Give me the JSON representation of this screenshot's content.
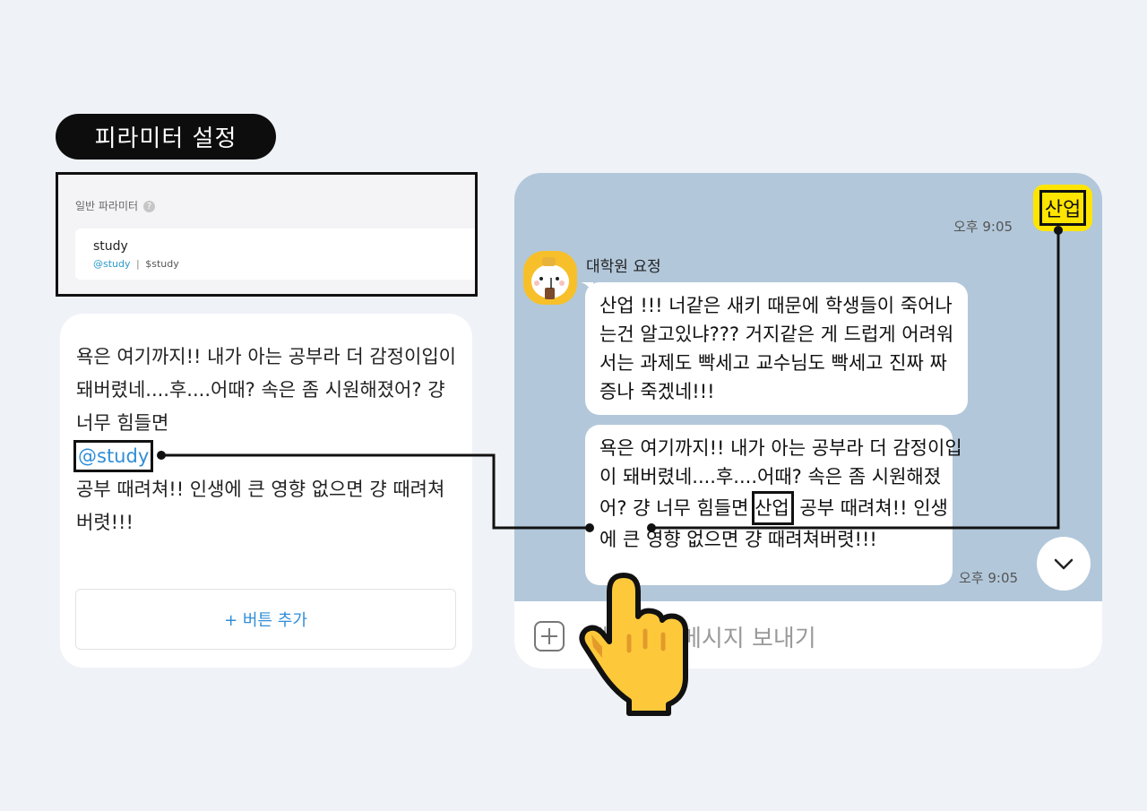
{
  "settings_badge": "피라미터 설정",
  "param_panel": {
    "title": "일반 파라미터",
    "help_glyph": "?",
    "param_name": "study",
    "param_alias": "@study",
    "param_sep": "|",
    "param_var": "$study"
  },
  "text_card": {
    "text_before": "욕은 여기까지!! 내가 아는 공부라 더 감정이입이 돼버렸네....후....어때? 속은 좀 시원해졌어? 걍 너무 힘들면",
    "mention": "@study",
    "text_after": " 공부 때려쳐!! 인생에 큰 영향 없으면 걍 때려쳐버렷!!!",
    "add_button": "+ 버튼 추가"
  },
  "chat": {
    "my_message": "산업",
    "my_time": "오후 9:05",
    "sender_name": "대학원 요정",
    "bubble1": "산업 !!! 너같은 새키 때문에 학생들이 죽어나는건 알고있냐??? 거지같은 게 드럽게 어려워서는 과제도 빡세고 교수님도 빡세고 진짜 짜증나 죽겠네!!!",
    "bubble2_before": "욕은 여기까지!! 내가 아는 공부라 더 감정이입이 돼버렸네....후....어때? 속은 좀 시원해졌어? 걍 너무 힘들면 ",
    "bubble2_highlight": "산업",
    "bubble2_after": " 공부 때려쳐!! 인생에 큰 영향 없으면 걍 때려쳐버렷!!!",
    "reply_time": "오후 9:05",
    "input_placeholder": "채팅방에 메시지 보내기"
  },
  "icons": {
    "help": "question-circle-icon",
    "scroll_down": "chevron-down-icon",
    "attach": "plus-square-icon",
    "pointer": "pointing-hand-icon",
    "avatar": "fairy-character-avatar"
  },
  "colors": {
    "page_bg": "#eff2f7",
    "chat_bg": "#b2c7da",
    "my_bubble": "#fee500",
    "link": "#2f8ed8",
    "hand": "#fdc93a"
  }
}
